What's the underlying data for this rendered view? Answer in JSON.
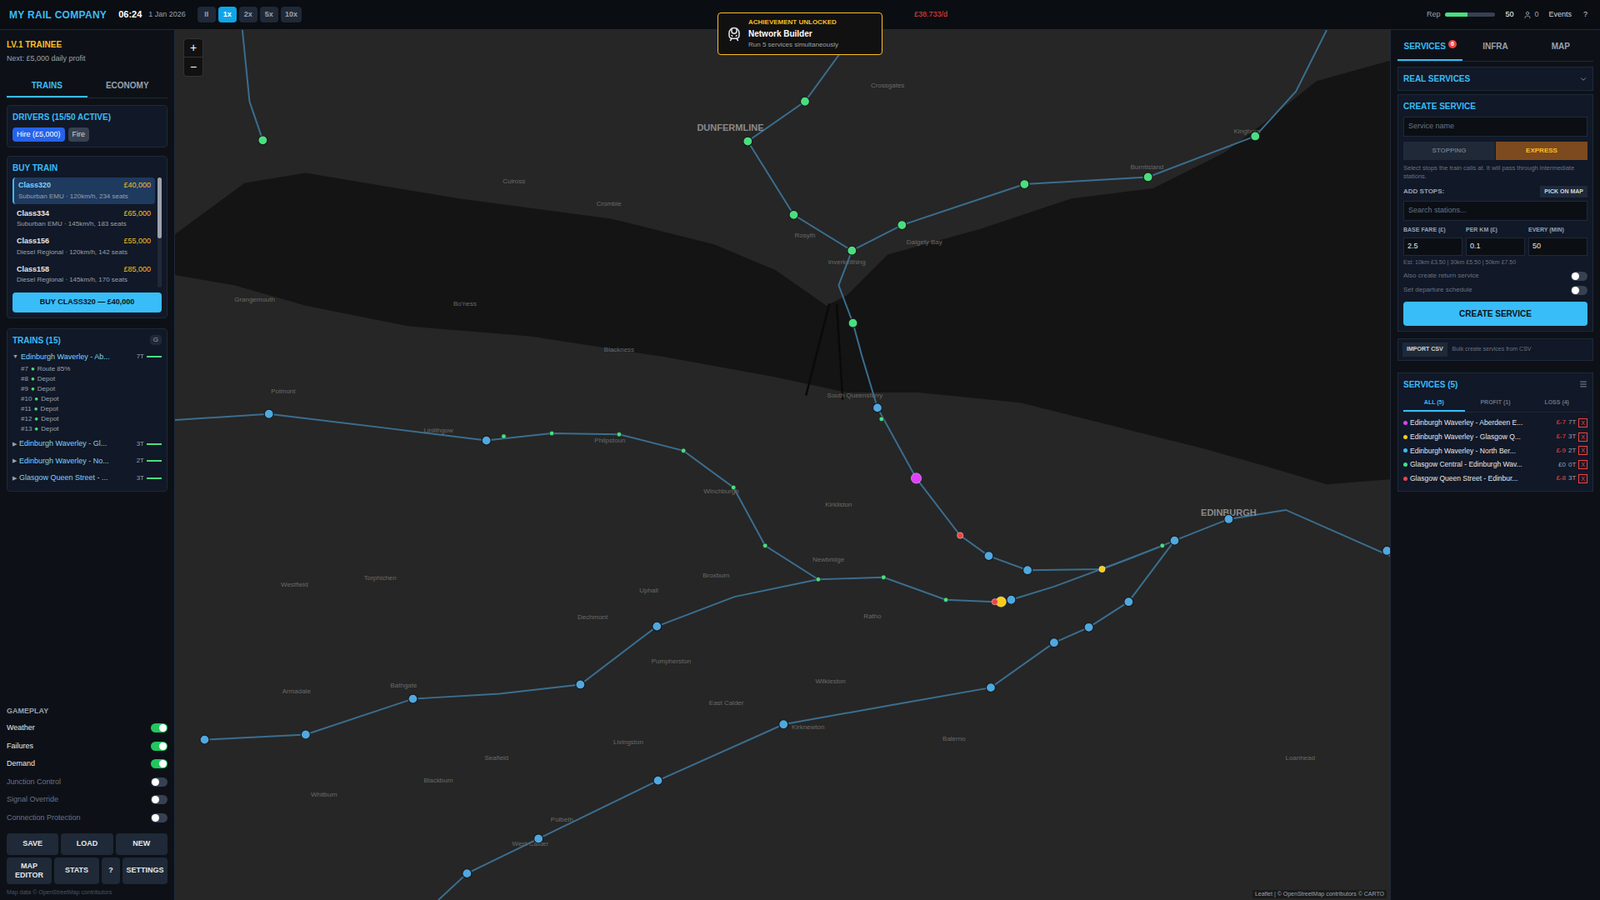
{
  "topbar": {
    "company": "MY RAIL COMPANY",
    "time": "06:24",
    "date": "1 Jan 2026",
    "speeds": [
      {
        "label": "II",
        "selected": false
      },
      {
        "label": "1x",
        "selected": true
      },
      {
        "label": "2x",
        "selected": false
      },
      {
        "label": "5x",
        "selected": false
      },
      {
        "label": "10x",
        "selected": false
      }
    ],
    "balance": "£38.733/d",
    "rep_label": "Rep",
    "rep_level": 0.45,
    "rep_value": "50",
    "passengers": "0",
    "events": "Events",
    "help": "?"
  },
  "achievement": {
    "heading": "ACHIEVEMENT UNLOCKED",
    "title": "Network Builder",
    "description": "Run 5 services simultaneously"
  },
  "left": {
    "level": "LV.1 TRAINEE",
    "next": "Next: £5,000 daily profit",
    "tabs": [
      {
        "label": "TRAINS",
        "selected": true
      },
      {
        "label": "ECONOMY",
        "selected": false
      }
    ],
    "drivers": {
      "title": "DRIVERS (15/50 ACTIVE)",
      "hire": "Hire (£5,000)",
      "fire": "Fire"
    },
    "buy_title": "BUY TRAIN",
    "buy_list": [
      {
        "name": "Class320",
        "price": "£40,000",
        "desc": "Suburban EMU · 120km/h, 234 seats",
        "selected": true
      },
      {
        "name": "Class334",
        "price": "£65,000",
        "desc": "Suburban EMU · 145km/h, 183 seats",
        "selected": false
      },
      {
        "name": "Class156",
        "price": "£55,000",
        "desc": "Diesel Regional · 120km/h, 142 seats",
        "selected": false
      },
      {
        "name": "Class158",
        "price": "£85,000",
        "desc": "Diesel Regional · 145km/h, 170 seats",
        "selected": false
      }
    ],
    "buy_level": 0.55,
    "buy_button": "BUY CLASS320 — £40,000",
    "trains_title": "TRAINS (15)",
    "trains_badge": "G",
    "groups": [
      {
        "arrow": "▼",
        "name": "Edinburgh Waverley - Ab...",
        "count": "7T",
        "expanded": true,
        "color": "#4ade80",
        "trains": [
          {
            "id": "#7",
            "dot": "●",
            "status": "Route 85%",
            "color": "#4ade80"
          },
          {
            "id": "#8",
            "dot": "●",
            "status": "Depot",
            "color": "#4ade80"
          },
          {
            "id": "#9",
            "dot": "●",
            "status": "Depot",
            "color": "#4ade80"
          },
          {
            "id": "#10",
            "dot": "●",
            "status": "Depot",
            "color": "#4ade80"
          },
          {
            "id": "#11",
            "dot": "●",
            "status": "Depot",
            "color": "#4ade80"
          },
          {
            "id": "#12",
            "dot": "●",
            "status": "Depot",
            "color": "#4ade80"
          },
          {
            "id": "#13",
            "dot": "●",
            "status": "Depot",
            "color": "#4ade80"
          }
        ]
      },
      {
        "arrow": "▶",
        "name": "Edinburgh Waverley - Gl...",
        "count": "3T",
        "expanded": false,
        "color": "#4ade80",
        "trains": []
      },
      {
        "arrow": "▶",
        "name": "Edinburgh Waverley - No...",
        "count": "2T",
        "expanded": false,
        "color": "#4ade80",
        "trains": []
      },
      {
        "arrow": "▶",
        "name": "Glasgow Queen Street - ...",
        "count": "3T",
        "expanded": false,
        "color": "#4ade80",
        "trains": []
      }
    ],
    "gameplay_title": "GAMEPLAY",
    "toggles": [
      {
        "label": "Weather",
        "on": true
      },
      {
        "label": "Failures",
        "on": true
      },
      {
        "label": "Demand",
        "on": true
      },
      {
        "label": "Junction Control",
        "on": false
      },
      {
        "label": "Signal Override",
        "on": false
      },
      {
        "label": "Connection Protection",
        "on": false
      }
    ],
    "buttons_row1": [
      "SAVE",
      "LOAD",
      "NEW"
    ],
    "buttons_row2": [
      "MAP EDITOR",
      "STATS",
      "?",
      "SETTINGS"
    ],
    "footer": "Map data © OpenStreetMap contributors"
  },
  "map": {
    "zoom_in": "+",
    "zoom_out": "−",
    "attribution": "Leaflet | © OpenStreetMap contributors © CARTO",
    "labels": [
      "DUNFERMLINE",
      "Rosyth",
      "Inverkeithing",
      "Dalgety Bay",
      "Burntisland",
      "Kinghorn",
      "South Queensferry",
      "Crossgates",
      "Crombie",
      "Culross",
      "Grangemouth",
      "Bo'ness",
      "Blackness",
      "Linlithgow",
      "Polmont",
      "Philpstoun",
      "Winchburgh",
      "Kirkliston",
      "Broxburn",
      "Newbridge",
      "Uphall",
      "Ratho",
      "Dechmont",
      "Pumpherston",
      "Bathgate",
      "Armadale",
      "Livingston",
      "East Calder",
      "Wilkieston",
      "Kirknewton",
      "Balerno",
      "Whitburn",
      "Blackburn",
      "EDINBURGH",
      "Torphichen",
      "Westfield",
      "Seafield",
      "Polbeth",
      "West Calder",
      "Loanhead"
    ],
    "stations": [
      {
        "kind": "major",
        "color": "#4ade80"
      },
      {
        "kind": "major",
        "color": "#4ade80"
      },
      {
        "kind": "major",
        "color": "#4ade80"
      },
      {
        "kind": "major",
        "color": "#4ade80"
      },
      {
        "kind": "major",
        "color": "#4ade80"
      },
      {
        "kind": "major",
        "color": "#4ade80"
      },
      {
        "kind": "major",
        "color": "#4ade80"
      },
      {
        "kind": "major",
        "color": "#4ade80"
      },
      {
        "kind": "major",
        "color": "#4ade80"
      },
      {
        "kind": "major",
        "color": "#4ade80"
      },
      {
        "kind": "major",
        "color": "#4fa8e0"
      },
      {
        "kind": "major",
        "color": "#4fa8e0"
      },
      {
        "kind": "major",
        "color": "#4fa8e0"
      },
      {
        "kind": "major",
        "color": "#4fa8e0"
      },
      {
        "kind": "major",
        "color": "#4fa8e0"
      },
      {
        "kind": "major",
        "color": "#4fa8e0"
      },
      {
        "kind": "major",
        "color": "#4fa8e0"
      },
      {
        "kind": "major",
        "color": "#4fa8e0"
      },
      {
        "kind": "major",
        "color": "#4fa8e0"
      },
      {
        "kind": "major",
        "color": "#4fa8e0"
      },
      {
        "kind": "major",
        "color": "#4fa8e0"
      },
      {
        "kind": "major",
        "color": "#4fa8e0"
      },
      {
        "kind": "major",
        "color": "#4fa8e0"
      },
      {
        "kind": "major",
        "color": "#4fa8e0"
      },
      {
        "kind": "major",
        "color": "#4fa8e0"
      },
      {
        "kind": "major",
        "color": "#4fa8e0"
      },
      {
        "kind": "major",
        "color": "#4fa8e0"
      },
      {
        "kind": "major",
        "color": "#4fa8e0"
      },
      {
        "kind": "major",
        "color": "#4fa8e0"
      },
      {
        "kind": "major",
        "color": "#4fa8e0"
      },
      {
        "kind": "major",
        "color": "#4fa8e0"
      },
      {
        "kind": "major",
        "color": "#4fa8e0"
      },
      {
        "kind": "minor",
        "color": "#4ade80"
      },
      {
        "kind": "minor",
        "color": "#4ade80"
      },
      {
        "kind": "minor",
        "color": "#4ade80"
      },
      {
        "kind": "minor",
        "color": "#4ade80"
      },
      {
        "kind": "minor",
        "color": "#4ade80"
      },
      {
        "kind": "minor",
        "color": "#4ade80"
      },
      {
        "kind": "minor",
        "color": "#4ade80"
      },
      {
        "kind": "minor",
        "color": "#4ade80"
      },
      {
        "kind": "minor",
        "color": "#4ade80"
      },
      {
        "kind": "minor",
        "color": "#4ade80"
      },
      {
        "kind": "minor",
        "color": "#4ade80"
      }
    ],
    "trains": [
      {
        "kind": "large",
        "color": "#e040fb"
      },
      {
        "kind": "small",
        "color": "#ef4444"
      },
      {
        "kind": "large",
        "color": "#facc15"
      },
      {
        "kind": "small",
        "color": "#ef4444"
      },
      {
        "kind": "small",
        "color": "#facc15"
      }
    ]
  },
  "right": {
    "tabs": [
      {
        "label": "SERVICES",
        "selected": true,
        "badge": "6"
      },
      {
        "label": "INFRA",
        "selected": false,
        "badge": ""
      },
      {
        "label": "MAP",
        "selected": false,
        "badge": ""
      }
    ],
    "real_services": "REAL SERVICES",
    "create": {
      "title": "CREATE SERVICE",
      "name_placeholder": "Service name",
      "modes": [
        {
          "label": "STOPPING",
          "selected": false
        },
        {
          "label": "EXPRESS",
          "selected": true
        }
      ],
      "help": "Select stops the train calls at. It will pass through intermediate stations.",
      "add_stops": "ADD STOPS:",
      "pick": "PICK ON MAP",
      "search_placeholder": "Search stations...",
      "fields": [
        {
          "label": "BASE FARE (£)",
          "value": "2.5"
        },
        {
          "label": "PER KM (£)",
          "value": "0.1"
        },
        {
          "label": "EVERY (MIN)",
          "value": "50"
        }
      ],
      "estimate": "Est: 10km £3.50 | 30km £5.50 | 50km £7.50",
      "toggles": [
        {
          "label": "Also create return service",
          "on": false
        },
        {
          "label": "Set departure schedule",
          "on": false
        }
      ],
      "button": "CREATE SERVICE"
    },
    "import": {
      "button": "IMPORT CSV",
      "text": "Bulk create services from CSV"
    },
    "services_title": "SERVICES (5)",
    "service_tabs": [
      {
        "label": "ALL (5)",
        "selected": true
      },
      {
        "label": "PROFIT (1)",
        "selected": false
      },
      {
        "label": "LOSS (4)",
        "selected": false
      }
    ],
    "services": [
      {
        "name": "Edinburgh Waverley - Aberdeen E...",
        "profit": "£-7",
        "count": "7T",
        "close": "X",
        "color": "#e040fb",
        "loss": true
      },
      {
        "name": "Edinburgh Waverley - Glasgow Q...",
        "profit": "£-7",
        "count": "3T",
        "close": "X",
        "color": "#facc15",
        "loss": true
      },
      {
        "name": "Edinburgh Waverley - North Ber...",
        "profit": "£-9",
        "count": "2T",
        "close": "X",
        "color": "#38bdf8",
        "loss": true
      },
      {
        "name": "Glasgow Central - Edinburgh Wav...",
        "profit": "£0",
        "count": "0T",
        "close": "X",
        "color": "#4ade80",
        "loss": false
      },
      {
        "name": "Glasgow Queen Street - Edinbur...",
        "profit": "£-8",
        "count": "3T",
        "close": "X",
        "color": "#ef4444",
        "loss": true
      }
    ]
  }
}
